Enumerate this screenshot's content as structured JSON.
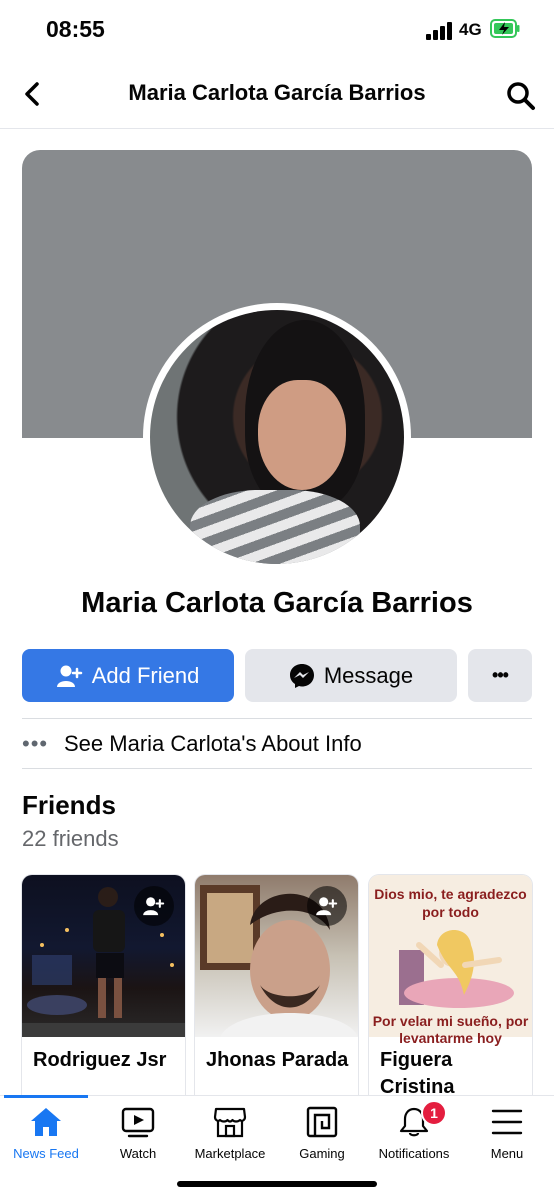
{
  "status": {
    "time": "08:55",
    "network": "4G"
  },
  "header": {
    "title": "Maria Carlota García Barrios"
  },
  "profile": {
    "name": "Maria Carlota García Barrios"
  },
  "actions": {
    "add_friend": "Add Friend",
    "message": "Message",
    "more": "•••"
  },
  "about": {
    "dots": "•••",
    "label": "See Maria Carlota's About Info"
  },
  "friends": {
    "title": "Friends",
    "count": "22 friends",
    "items": [
      {
        "name": "Rodriguez Jsr"
      },
      {
        "name": "Jhonas Parada"
      },
      {
        "name": "Figuera Cristina",
        "meme_top": "Dios mio, te agradezco por todo",
        "meme_bottom": "Por velar mi sueño, por levantarme hoy"
      }
    ]
  },
  "tabs": [
    {
      "label": "News Feed",
      "icon": "home-icon",
      "active": true
    },
    {
      "label": "Watch",
      "icon": "watch-icon"
    },
    {
      "label": "Marketplace",
      "icon": "marketplace-icon"
    },
    {
      "label": "Gaming",
      "icon": "gaming-icon"
    },
    {
      "label": "Notifications",
      "icon": "bell-icon",
      "badge": "1"
    },
    {
      "label": "Menu",
      "icon": "menu-icon"
    }
  ],
  "colors": {
    "accent": "#1877f2",
    "add_friend_bg": "#3578e5",
    "badge": "#e41e3f",
    "cover": "#888b8e"
  }
}
